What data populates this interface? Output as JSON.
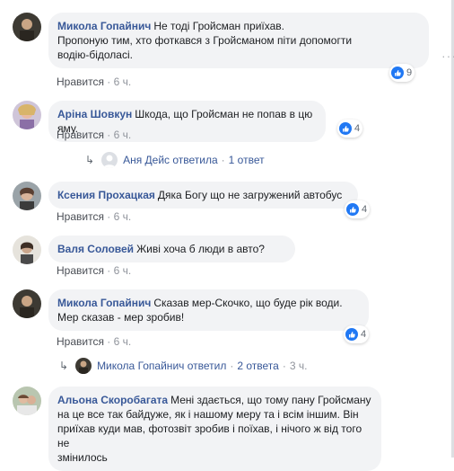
{
  "colors": {
    "author": "#385898",
    "bubble": "#f2f3f5",
    "meta": "#90949c",
    "like_blue": "#2078f4"
  },
  "comments": [
    {
      "author": "Микола Гопайнич",
      "lines": [
        "Не тоді Гройсман приїхав.",
        "Пропоную тим, хто фоткався з Гройсманом піти допомогти",
        "водію-бідоласі."
      ],
      "like_label": "Нравится",
      "time": "6 ч.",
      "reactions": "9",
      "more_icon": "more-dots-icon"
    },
    {
      "author": "Аріна Шовкун",
      "lines": [
        "Шкода, що Гройсман не попав в цю яму."
      ],
      "like_label": "Нравится",
      "time": "6 ч.",
      "reactions": "4"
    },
    {
      "author": "Ксения Прохацкая",
      "lines": [
        "Дяка Богу що не загружений автобус"
      ],
      "like_label": "Нравится",
      "time": "6 ч.",
      "reactions": "4"
    },
    {
      "author": "Валя Соловей",
      "lines": [
        "Живі хоча б люди в авто?"
      ],
      "like_label": "Нравится",
      "time": "6 ч."
    },
    {
      "author": "Микола Гопайнич",
      "lines": [
        "Сказав мер-Скочко, що буде рік води.",
        "Мер сказав - мер зробив!"
      ],
      "like_label": "Нравится",
      "time": "6 ч.",
      "reactions": "4"
    },
    {
      "author": "Альона Скоробагата",
      "lines": [
        "Мені здається, що тому пану Гройсману",
        "на це все так байдуже, як і нашому меру та і всім іншим. Він",
        "приїхав куди мав, фотозвіт зробив і поїхав, і нічого ж від того не",
        "змінилось"
      ]
    }
  ],
  "replies": [
    {
      "text": "Аня Дейс ответила",
      "count": "1 ответ",
      "sep": "·"
    },
    {
      "text": "Микола Гопайнич ответил",
      "count": "2 ответа",
      "sep": "·",
      "time": "3 ч."
    }
  ],
  "separators": {
    "dot": "·"
  }
}
